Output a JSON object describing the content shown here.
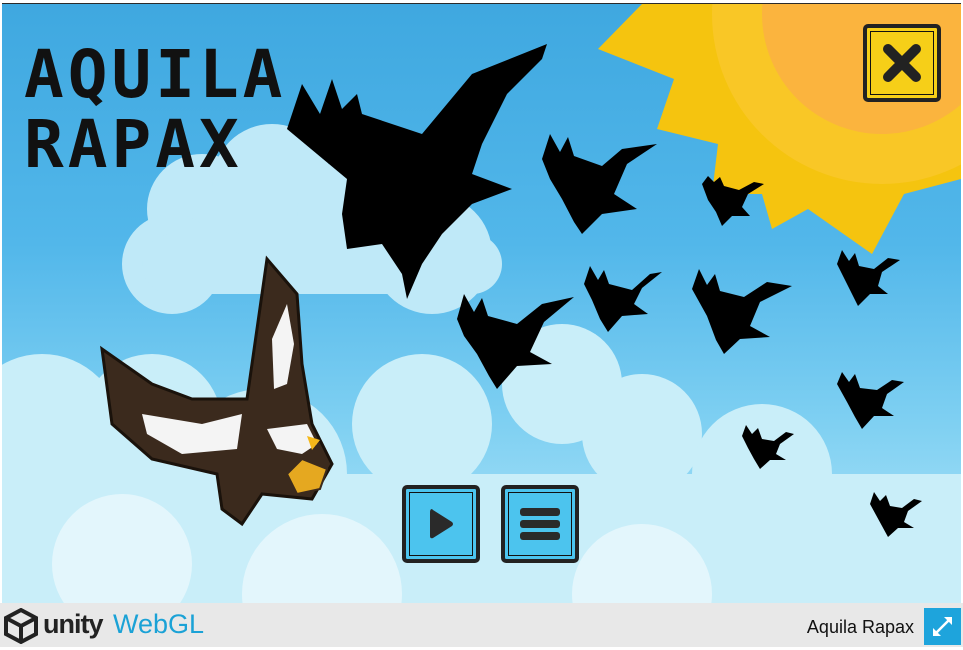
{
  "game": {
    "title_line1": "AQUILA",
    "title_line2": "RAPAX"
  },
  "buttons": {
    "close_icon": "close-x-icon",
    "play_icon": "play-triangle-icon",
    "menu_icon": "hamburger-menu-icon"
  },
  "footer": {
    "brand": "unity",
    "product": "WebGL",
    "game_title": "Aquila Rapax",
    "fullscreen_icon": "fullscreen-expand-icon"
  },
  "colors": {
    "sky": "#4fb4e9",
    "sun": "#f6cf18",
    "button_blue": "#4cc4ee",
    "webgl_blue": "#1ba2d6",
    "footer_bg": "#e8e8e8"
  }
}
